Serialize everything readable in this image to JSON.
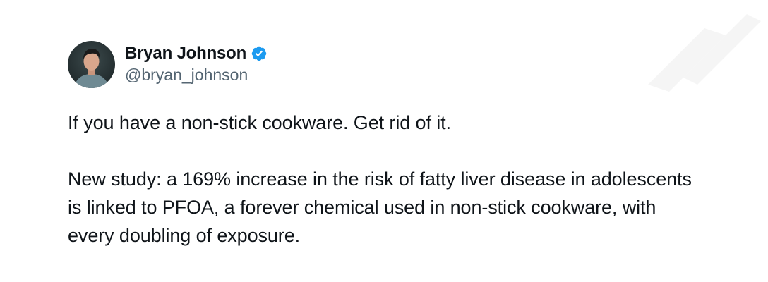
{
  "tweet": {
    "author": {
      "display_name": "Bryan Johnson",
      "handle": "@bryan_johnson",
      "verified": true,
      "verified_icon": "verified-badge-icon",
      "verified_color": "#1d9bf0"
    },
    "paragraphs": [
      "If you have a non-stick cookware. Get rid of it.",
      "New study: a 169% increase in the risk of fatty liver disease in adolescents is linked to PFOA, a forever chemical used in non-stick cookware, with every doubling of exposure."
    ]
  }
}
